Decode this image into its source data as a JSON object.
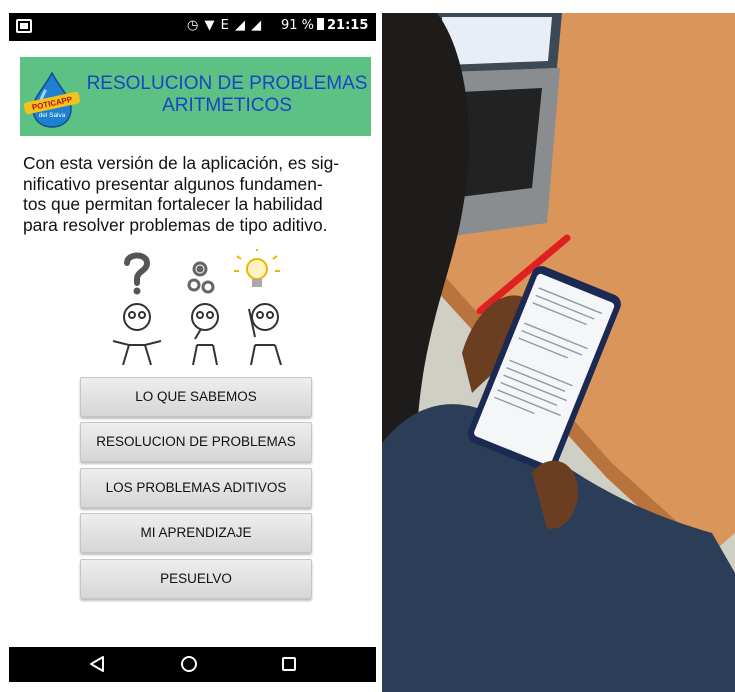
{
  "status_bar": {
    "icons": "◷ ▼ E ◢ ◢",
    "battery": "91 %",
    "time": "21:15"
  },
  "banner": {
    "logo_text": "POTICAPP del Salva",
    "title_line1": "RESOLUCION DE PROBLEMAS",
    "title_line2": "ARITMETICOS",
    "background_color": "#5cc182",
    "title_color": "#1a45c7"
  },
  "intro": {
    "lines": [
      "Con esta versión de la aplicación, es sig-",
      "nificativo presentar algunos fundamen-",
      "tos que permitan fortalecer la habilidad",
      "para resolver problemas de tipo aditivo."
    ]
  },
  "illustration": {
    "icons": [
      "question-icon",
      "gears-icon",
      "lightbulb-icon"
    ]
  },
  "menu": {
    "buttons": [
      "LO QUE SABEMOS",
      "RESOLUCION DE PROBLEMAS",
      "LOS PROBLEMAS ADITIVOS",
      "MI APRENDIZAJE",
      "PESUELVO"
    ]
  },
  "nav_bar": {
    "back": "◁",
    "home": "○",
    "recent": "□"
  }
}
